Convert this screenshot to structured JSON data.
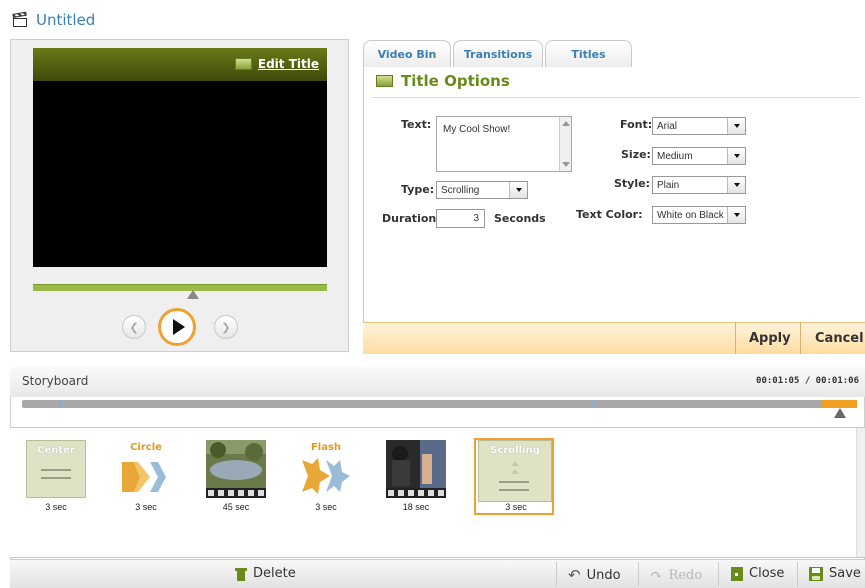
{
  "window": {
    "title": "Untitled"
  },
  "preview": {
    "edit_title_label": "Edit Title"
  },
  "tabs": [
    {
      "label": "Video Bin",
      "active": false
    },
    {
      "label": "Transitions",
      "active": false
    },
    {
      "label": "Titles",
      "active": true
    }
  ],
  "title_options": {
    "header": "Title Options",
    "text_label": "Text:",
    "text_value": "My Cool Show!",
    "type_label": "Type:",
    "type_value": "Scrolling",
    "duration_label": "Duration:",
    "duration_value": "3",
    "duration_unit": "Seconds",
    "font_label": "Font:",
    "font_value": "Arial",
    "size_label": "Size:",
    "size_value": "Medium",
    "style_label": "Style:",
    "style_value": "Plain",
    "text_color_label": "Text Color:",
    "text_color_value": "White on Black"
  },
  "actions": {
    "apply": "Apply",
    "cancel": "Cancel"
  },
  "storyboard": {
    "title": "Storyboard",
    "time": "00:01:05 / 00:01:06",
    "clips": [
      {
        "kind": "title",
        "label": "Center",
        "duration": "3 sec"
      },
      {
        "kind": "transition",
        "label": "Circle",
        "duration": "3 sec"
      },
      {
        "kind": "video",
        "label": "",
        "duration": "45 sec"
      },
      {
        "kind": "transition",
        "label": "Flash",
        "duration": "3 sec"
      },
      {
        "kind": "video",
        "label": "",
        "duration": "18 sec"
      },
      {
        "kind": "title",
        "label": "Scrolling",
        "duration": "3 sec",
        "selected": true
      }
    ]
  },
  "toolbar": {
    "delete": "Delete",
    "undo": "Undo",
    "redo": "Redo",
    "close": "Close",
    "save": "Save"
  },
  "colors": {
    "accent_blue": "#3a7fb4",
    "accent_green": "#6a8a1a",
    "accent_orange": "#f0a030"
  }
}
